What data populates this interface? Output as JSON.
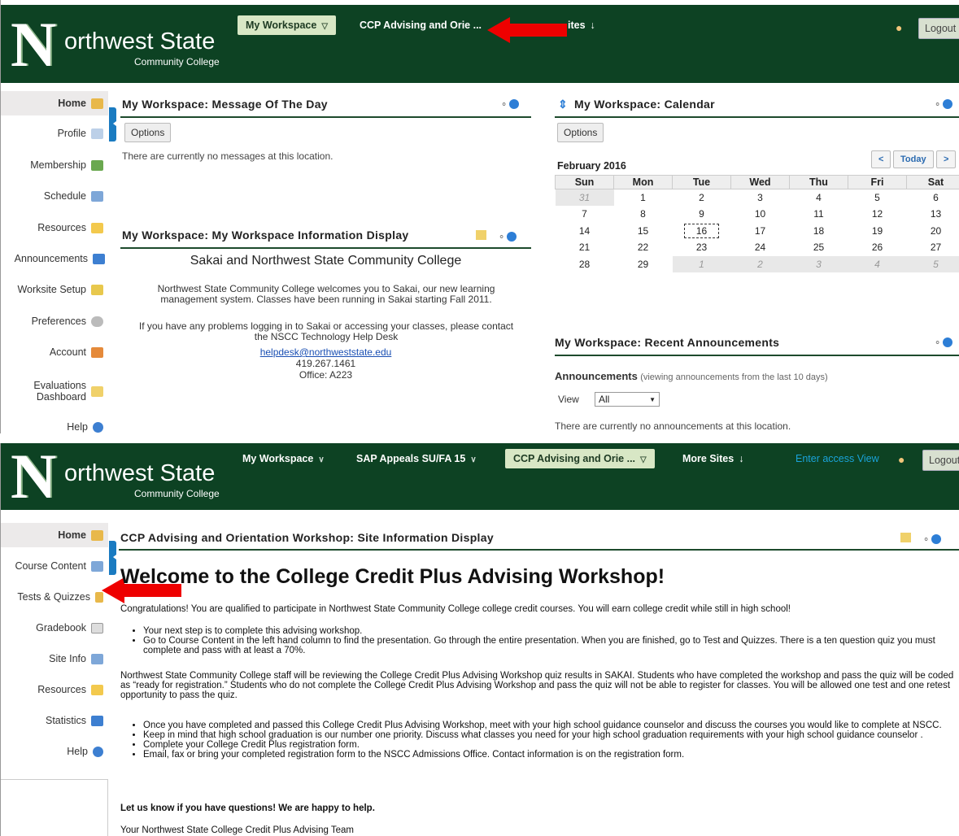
{
  "top": {
    "logo": {
      "n": "N",
      "line1": "orthwest State",
      "line2": "Community College"
    },
    "nav": {
      "my_workspace": "My Workspace",
      "site_truncated": "CCP Advising and Orie ...",
      "more_sites_partial": "ites"
    },
    "logout": "Logout",
    "sidebar": [
      {
        "label": "Home"
      },
      {
        "label": "Profile"
      },
      {
        "label": "Membership"
      },
      {
        "label": "Schedule"
      },
      {
        "label": "Resources"
      },
      {
        "label": "Announcements"
      },
      {
        "label": "Worksite Setup"
      },
      {
        "label": "Preferences"
      },
      {
        "label": "Account"
      },
      {
        "label": "Evaluations Dashboard"
      },
      {
        "label": "Help"
      }
    ],
    "motd": {
      "title": "My Workspace: Message Of The Day",
      "options": "Options",
      "empty": "There are currently no messages at this location."
    },
    "info": {
      "title": "My Workspace: My Workspace Information Display",
      "heading": "Sakai and Northwest State Community College",
      "p1": "Northwest State Community College welcomes you to Sakai, our new learning management system. Classes have been running in Sakai starting Fall 2011.",
      "p2": "If you have any problems logging in to Sakai or accessing your classes, please contact the NSCC Technology Help Desk",
      "email": "helpdesk@northweststate.edu",
      "phone": "419.267.1461",
      "office": "Office: A223"
    },
    "calendar": {
      "title": "My Workspace: Calendar",
      "options": "Options",
      "month": "February 2016",
      "prev": "<",
      "today": "Today",
      "next": ">",
      "days": [
        "Sun",
        "Mon",
        "Tue",
        "Wed",
        "Thu",
        "Fri",
        "Sat"
      ],
      "weeks": [
        [
          "31",
          "1",
          "2",
          "3",
          "4",
          "5",
          "6"
        ],
        [
          "7",
          "8",
          "9",
          "10",
          "11",
          "12",
          "13"
        ],
        [
          "14",
          "15",
          "16",
          "17",
          "18",
          "19",
          "20"
        ],
        [
          "21",
          "22",
          "23",
          "24",
          "25",
          "26",
          "27"
        ],
        [
          "28",
          "29",
          "1",
          "2",
          "3",
          "4",
          "5"
        ]
      ]
    },
    "announcements": {
      "title": "My Workspace: Recent Announcements",
      "heading": "Announcements",
      "note": "(viewing announcements from the last 10 days)",
      "view_label": "View",
      "view_value": "All",
      "empty": "There are currently no announcements at this location."
    }
  },
  "bottom": {
    "nav": {
      "my_workspace": "My Workspace",
      "sap": "SAP Appeals SU/FA 15",
      "site": "CCP Advising and Orie ...",
      "more_sites": "More Sites",
      "access": "Enter access View"
    },
    "logout": "Logout",
    "sidebar": [
      {
        "label": "Home"
      },
      {
        "label": "Course Content"
      },
      {
        "label": "Tests & Quizzes"
      },
      {
        "label": "Gradebook"
      },
      {
        "label": "Site Info"
      },
      {
        "label": "Resources"
      },
      {
        "label": "Statistics"
      },
      {
        "label": "Help"
      }
    ],
    "panel_title": "CCP Advising and Orientation Workshop: Site Information Display",
    "welcome": "Welcome to the College Credit Plus Advising Workshop!",
    "p1": "Congratulations!  You are qualified to participate in Northwest State Community College college credit courses.  You will earn college credit while still in high school!",
    "list1": [
      "Your next step is to complete this advising workshop.",
      "Go to Course Content in the left hand column to find the presentation.  Go through the entire presentation.  When you are finished, go to Test and Quizzes.  There is a ten question quiz you must complete and pass with at least a 70%."
    ],
    "p2": "Northwest State Community College staff will be reviewing the College Credit Plus Advising Workshop quiz results in SAKAI.   Students who have completed the workshop and pass the quiz will be coded as “ready for registration.”  Students who do not complete the College Credit Plus Advising Workshop and pass the quiz will not be able to register for classes.  You will be allowed one test and one retest opportunity to pass the quiz.",
    "list2": [
      "Once you have completed and passed this College Credit Plus Advising Workshop, meet with your high school guidance counselor and discuss the courses you would like to complete at NSCC.",
      "Keep in mind that high school graduation is our number one priority.  Discuss what classes you need for your high school graduation requirements with your high school guidance counselor .",
      "Complete your College Credit Plus registration form.",
      "Email, fax or bring your completed registration form to the NSCC Admissions Office. Contact information is on the registration form."
    ],
    "closing": "Let us know if you have questions!  We are happy to help.",
    "signature": "Your Northwest State College Credit Plus Advising Team"
  },
  "colors": {
    "header": "#0d4223",
    "selected_tab": "#d8e7c5",
    "accent": "#1a7bc1",
    "arrow": "#e00000"
  }
}
